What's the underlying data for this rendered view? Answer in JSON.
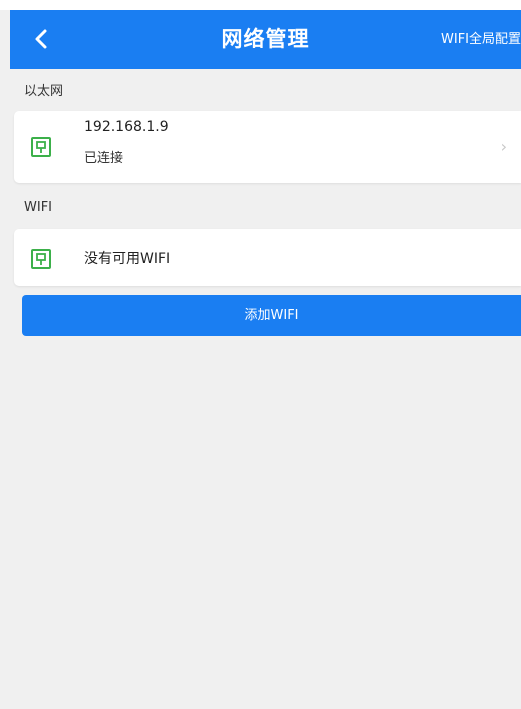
{
  "header": {
    "title": "网络管理",
    "right_action": "WIFI全局配置",
    "color": "#1a7ef2"
  },
  "ethernet": {
    "section_label": "以太网",
    "items": [
      {
        "ip": "192.168.1.9",
        "status": "已连接",
        "icon": "network-port-icon",
        "chevron": "›"
      }
    ]
  },
  "wifi": {
    "section_label": "WIFI",
    "items": [
      {
        "text": "没有可用WIFI",
        "icon": "network-port-icon"
      }
    ],
    "add_button_label": "添加WIFI"
  },
  "colors": {
    "accent": "#1a7ef2",
    "icon_green": "#3cb04a",
    "background": "#f0f0f0"
  }
}
